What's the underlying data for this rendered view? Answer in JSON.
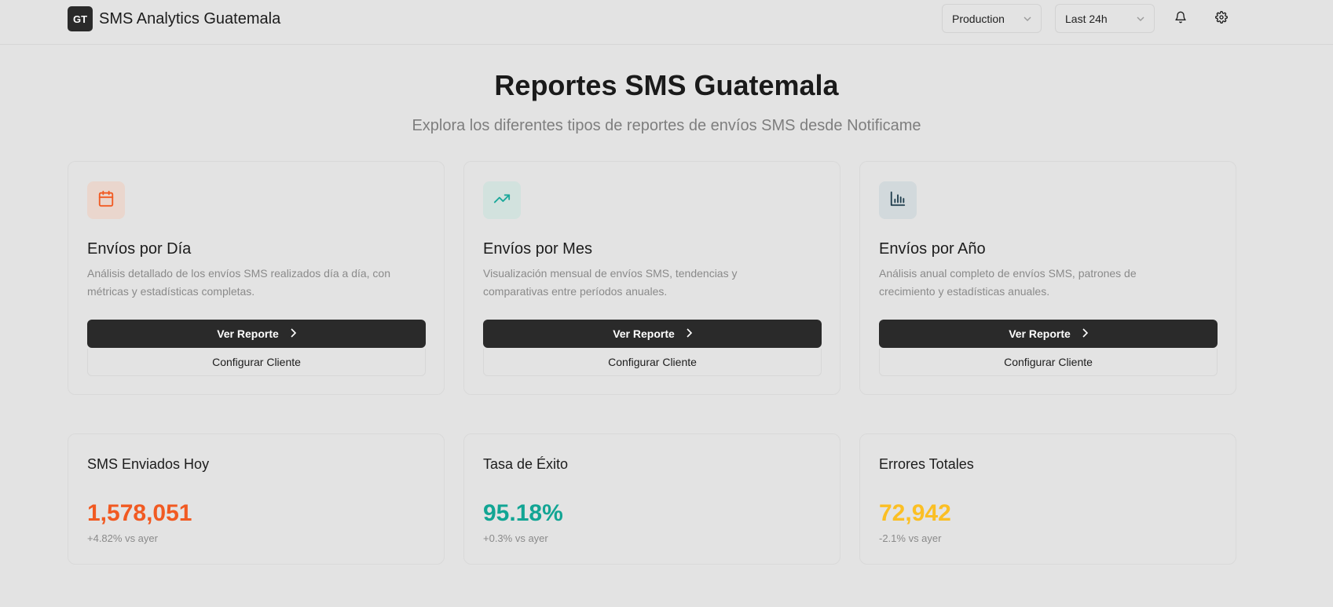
{
  "header": {
    "logo_text": "GT",
    "app_name": "SMS Analytics Guatemala",
    "environment_select": "Production",
    "time_select": "Last 24h",
    "icons": [
      "bell-icon",
      "gear-icon"
    ]
  },
  "hero": {
    "title": "Reportes SMS Guatemala",
    "subtitle": "Explora los diferentes tipos de reportes de envíos SMS desde Notificame"
  },
  "reports": [
    {
      "icon": "calendar-icon",
      "icon_color": "#f15a22",
      "icon_bg": "#ead6cd",
      "title": "Envíos por Día",
      "description": "Análisis detallado de los envíos SMS realizados día a día, con métricas y estadísticas completas.",
      "primary_label": "Ver Reporte",
      "secondary_label": "Configurar Cliente"
    },
    {
      "icon": "trending-up-icon",
      "icon_color": "#1aa89a",
      "icon_bg": "#d2e2de",
      "title": "Envíos por Mes",
      "description": "Visualización mensual de envíos SMS, tendencias y comparativas entre períodos anuales.",
      "primary_label": "Ver Reporte",
      "secondary_label": "Configurar Cliente"
    },
    {
      "icon": "bar-chart-icon",
      "icon_color": "#1f3d4d",
      "icon_bg": "#d2d9dc",
      "title": "Envíos por Año",
      "description": "Análisis anual completo de envíos SMS, patrones de crecimiento y estadísticas anuales.",
      "primary_label": "Ver Reporte",
      "secondary_label": "Configurar Cliente"
    }
  ],
  "stats": [
    {
      "title": "SMS Enviados Hoy",
      "value": "1,578,051",
      "delta": "+4.82% vs ayer",
      "color": "#f15a22"
    },
    {
      "title": "Tasa de Éxito",
      "value": "95.18%",
      "delta": "+0.3% vs ayer",
      "color": "#12a594"
    },
    {
      "title": "Errores Totales",
      "value": "72,942",
      "delta": "-2.1% vs ayer",
      "color": "#fbbf24"
    }
  ]
}
